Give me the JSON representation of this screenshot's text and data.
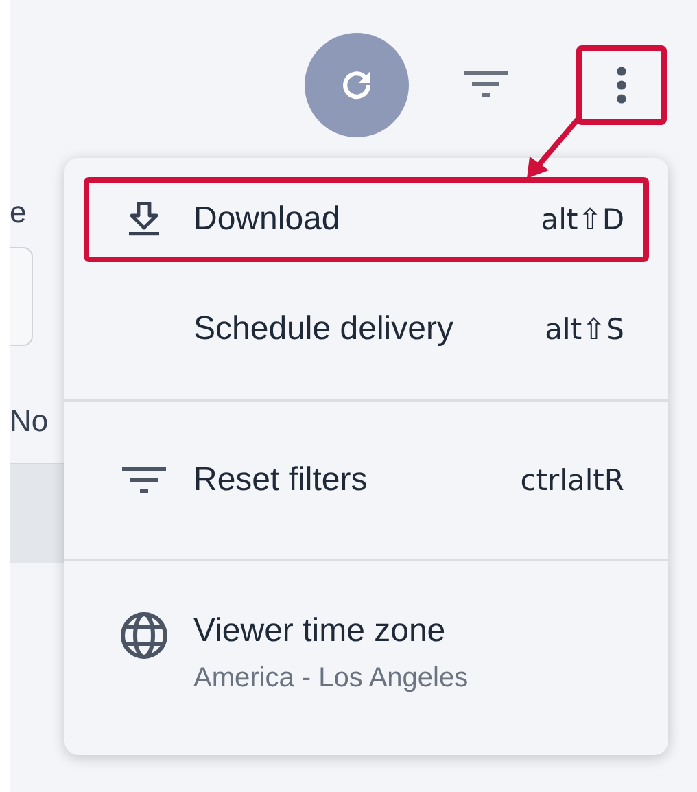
{
  "background": {
    "label_fragment": "e",
    "column_fragment": "No"
  },
  "toolbar": {
    "refresh_button": {
      "kind": "refresh"
    },
    "filter_button": {
      "kind": "filter"
    },
    "more_button": {
      "kind": "more",
      "highlighted": true
    }
  },
  "menu": {
    "sections": [
      [
        {
          "kind": "download",
          "label": "Download",
          "shortcut": "alt⇧D",
          "highlighted": true
        },
        {
          "kind": "plain",
          "label": "Schedule delivery",
          "shortcut": "alt⇧S",
          "highlighted": false
        }
      ],
      [
        {
          "kind": "filter",
          "label": "Reset filters",
          "shortcut": "ctrlaltR",
          "highlighted": false
        }
      ],
      [
        {
          "kind": "globe",
          "label": "Viewer time zone",
          "value": "America - Los Angeles",
          "highlighted": false
        }
      ]
    ]
  }
}
